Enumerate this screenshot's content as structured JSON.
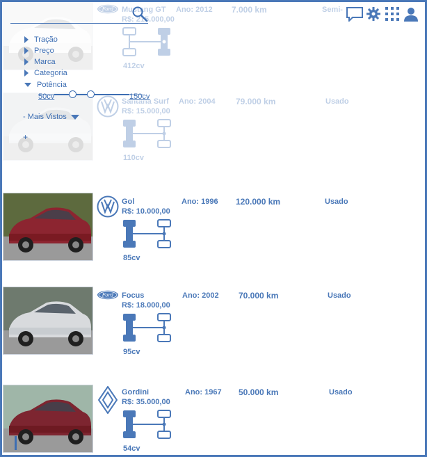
{
  "listings": [
    {
      "model": "Mustang GT",
      "price": "R$: 215.000,00",
      "year": "Ano: 2012",
      "km": "7.000 km",
      "condition": "Semi-",
      "power": "412cv",
      "brand_icon": "ford-logo-icon",
      "photo": "white-mustang-photo"
    },
    {
      "model": "Santana Surf",
      "price": "R$: 15.000,00",
      "year": "Ano: 2004",
      "km": "79.000 km",
      "condition": "Usado",
      "power": "110cv",
      "brand_icon": "volkswagen-logo-icon",
      "photo": "silver-santana-photo"
    },
    {
      "model": "Gol",
      "price": "R$: 10.000,00",
      "year": "Ano: 1996",
      "km": "120.000 km",
      "condition": "Usado",
      "power": "85cv",
      "brand_icon": "volkswagen-logo-icon",
      "photo": "red-gol-photo"
    },
    {
      "model": "Focus",
      "price": "R$: 18.000,00",
      "year": "Ano: 2002",
      "km": "70.000 km",
      "condition": "Usado",
      "power": "95cv",
      "brand_icon": "ford-logo-icon",
      "photo": "silver-focus-photo"
    },
    {
      "model": "Gordini",
      "price": "R$: 35.000,00",
      "year": "Ano: 1967",
      "km": "50.000 km",
      "condition": "Usado",
      "power": "54cv",
      "brand_icon": "renault-logo-icon",
      "photo": "red-gordini-photo"
    }
  ],
  "filters": {
    "items": [
      "Tração",
      "Preço",
      "Marca",
      "Categoria",
      "Potência"
    ],
    "slider_min": "50cv",
    "slider_max": "150cv",
    "sort_label": "- Mais Vistos",
    "add_label": "+"
  },
  "brand_text": {
    "ford": "Ford"
  },
  "header_icons": [
    "chat-icon",
    "gear-icon",
    "grid-icon",
    "user-icon"
  ],
  "colors": {
    "accent": "#4a78b8"
  }
}
